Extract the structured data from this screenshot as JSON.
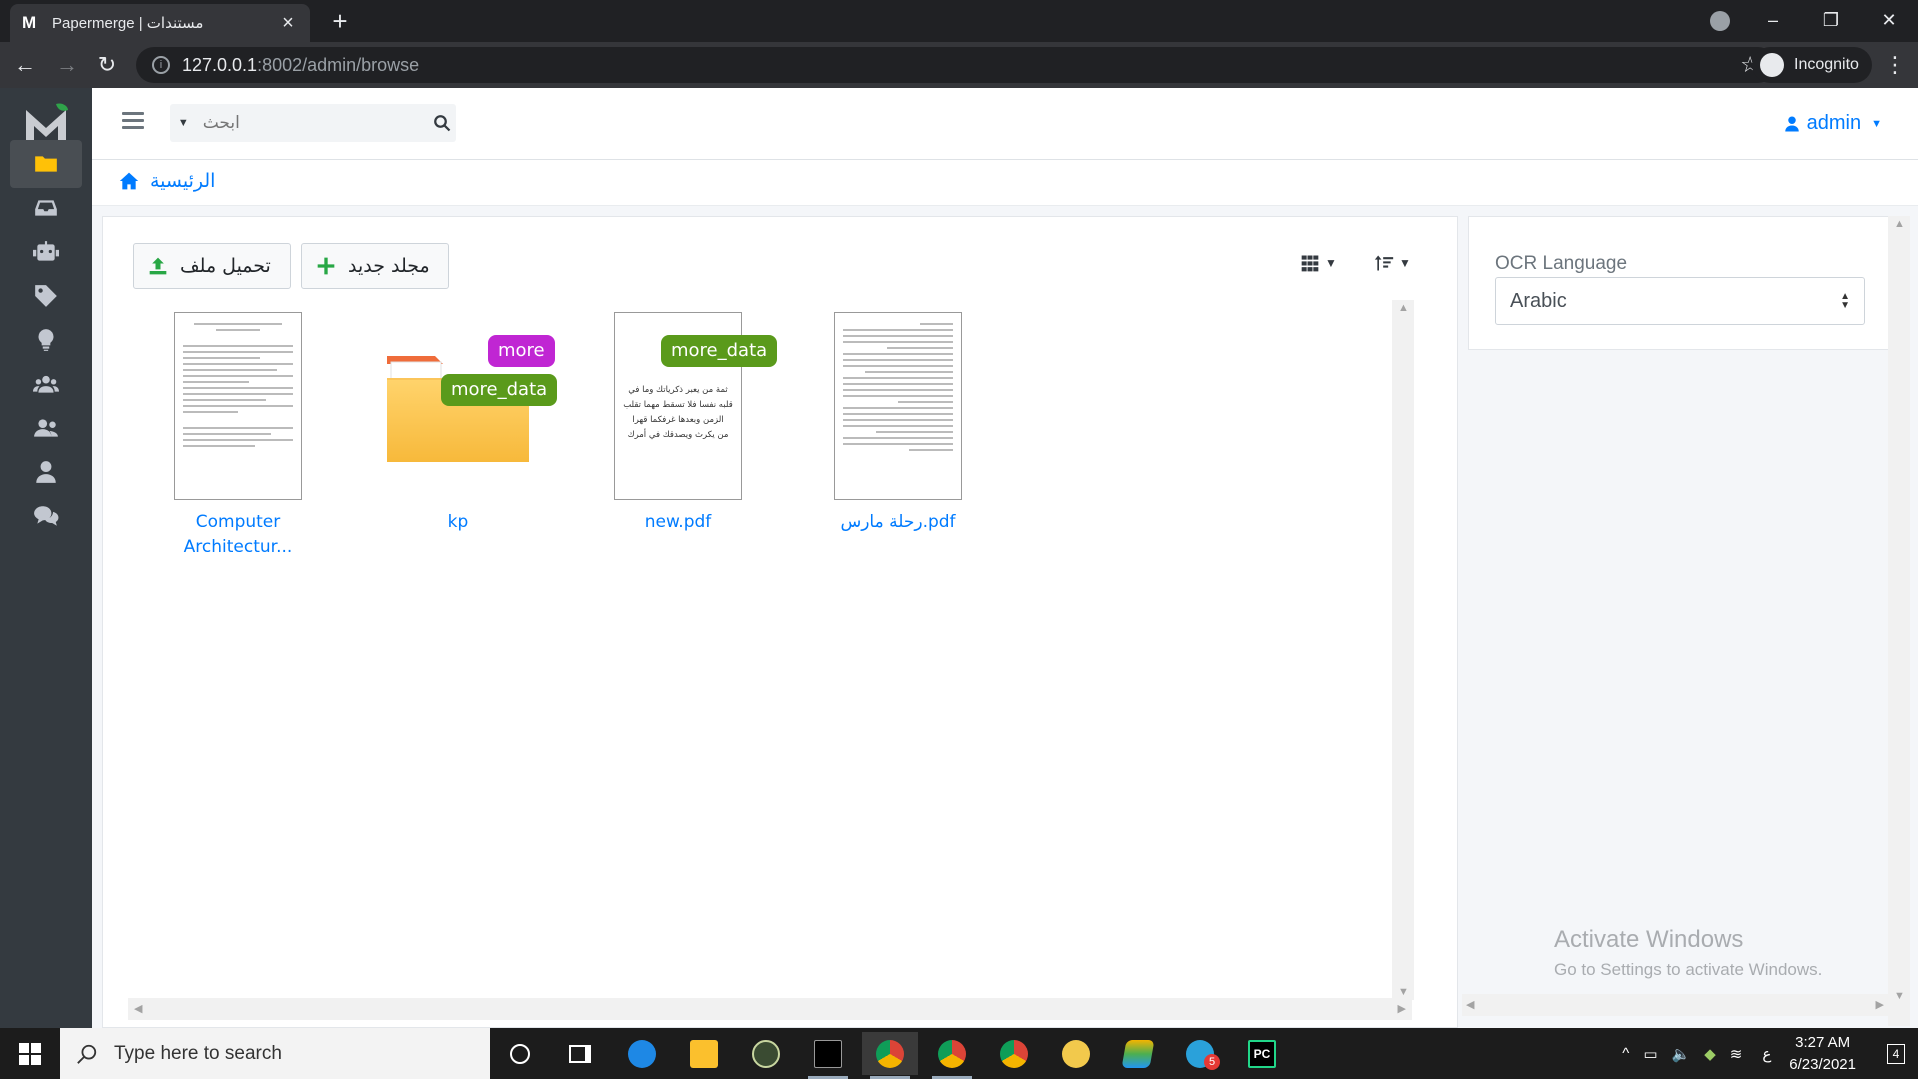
{
  "browser": {
    "tab_title": "Papermerge | مستندات",
    "url_host": "127.0.0.1",
    "url_rest": ":8002/admin/browse",
    "incognito_label": "Incognito"
  },
  "navbar": {
    "search_placeholder": "ابحث",
    "user_label": "admin"
  },
  "breadcrumb": {
    "home_label": "الرئيسية"
  },
  "toolbar": {
    "upload_label": "تحميل ملف",
    "new_folder_label": "مجلد جديد"
  },
  "items": [
    {
      "label_line1": "Computer",
      "label_line2": "Architectur...",
      "kind": "document"
    },
    {
      "label": "kp",
      "kind": "folder",
      "tags": [
        "more",
        "more_data"
      ]
    },
    {
      "label": "new.pdf",
      "kind": "document",
      "tags": [
        "more_data"
      ],
      "preview_lines": [
        "ثمة من يعبر ذكرياتك وما في",
        "قلبه نفسا فلا تسقط مهما تقلب",
        "الزمن وبعدها غرفكما قهرا",
        "من يكرث ويصدقك في أمرك"
      ]
    },
    {
      "label": "رحلة مارس.pdf",
      "kind": "document"
    }
  ],
  "tag_colors": {
    "more": "#c026d3",
    "more_data": "#5a9a1b"
  },
  "side_panel": {
    "ocr_label": "OCR Language",
    "ocr_value": "Arabic"
  },
  "watermark": {
    "line1": "Activate Windows",
    "line2": "Go to Settings to activate Windows."
  },
  "taskbar": {
    "search_placeholder": "Type here to search",
    "lang": "ع",
    "time": "3:27 AM",
    "date": "6/23/2021",
    "notif_count": "4",
    "telegram_badge": "5"
  }
}
